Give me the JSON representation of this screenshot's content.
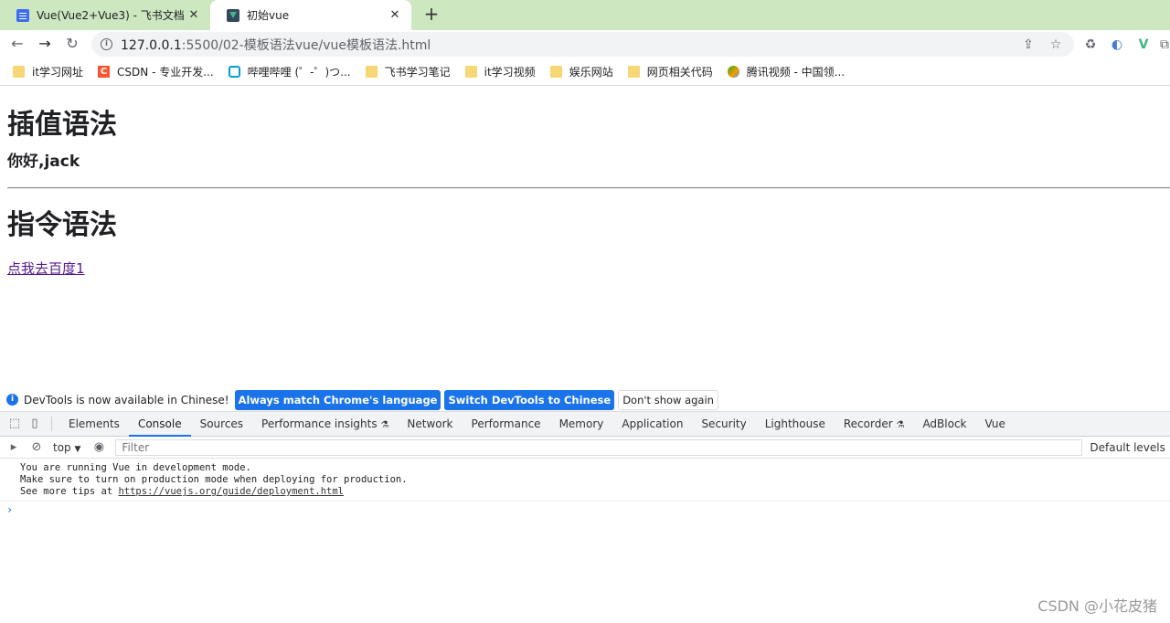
{
  "tabs": [
    {
      "title": "Vue(Vue2+Vue3) - 飞书文档",
      "icon": "document-icon"
    },
    {
      "title": "初始vue",
      "icon": "vue-icon"
    }
  ],
  "address": {
    "host": "127.0.0.1",
    "path": ":5500/02-模板语法vue/vue模板语法.html"
  },
  "bookmarks": [
    {
      "label": "it学习网址",
      "icon": "folder"
    },
    {
      "label": "CSDN - 专业开发...",
      "icon": "csdn"
    },
    {
      "label": "哔哩哔哩 (゜-゜)つ...",
      "icon": "bilibili"
    },
    {
      "label": "飞书学习笔记",
      "icon": "folder"
    },
    {
      "label": "it学习视频",
      "icon": "folder"
    },
    {
      "label": "娱乐网站",
      "icon": "folder"
    },
    {
      "label": "网页相关代码",
      "icon": "folder"
    },
    {
      "label": "腾讯视频 - 中国领...",
      "icon": "tencent"
    }
  ],
  "page": {
    "heading1": "插值语法",
    "greeting": "你好,jack",
    "heading2": "指令语法",
    "link": "点我去百度1"
  },
  "langbar": {
    "message": "DevTools is now available in Chinese!",
    "btn_match": "Always match Chrome's language",
    "btn_switch": "Switch DevTools to Chinese",
    "btn_dismiss": "Don't show again"
  },
  "devtools_tabs": [
    "Elements",
    "Console",
    "Sources",
    "Performance insights",
    "Network",
    "Performance",
    "Memory",
    "Application",
    "Security",
    "Lighthouse",
    "Recorder",
    "AdBlock",
    "Vue"
  ],
  "console_toolbar": {
    "context": "top",
    "filter_placeholder": "Filter",
    "levels": "Default levels"
  },
  "console": {
    "line1": "You are running Vue in development mode.",
    "line2": "Make sure to turn on production mode when deploying for production.",
    "line3_prefix": "See more tips at ",
    "line3_link": "https://vuejs.org/guide/deployment.html",
    "prompt": "›"
  },
  "watermark": "CSDN @小花皮猪"
}
